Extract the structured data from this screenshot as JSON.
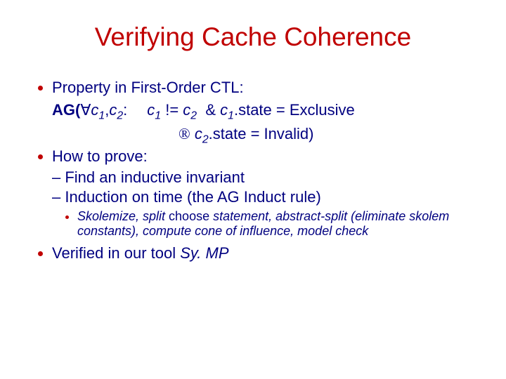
{
  "title": "Verifying Cache Coherence",
  "b1": "Property in First-Order CTL:",
  "f": {
    "ag": "AG(",
    "forall": "∀",
    "c1": "c",
    "s1": "1",
    "comma": ",",
    "c2": "c",
    "s2": "2",
    "colon": ":",
    "ne": "!=",
    "amp": "&",
    "state1": ".state = Exclusive",
    "imp": "®",
    "state2": ".state = Invalid)"
  },
  "b2": "How to prove:",
  "b2a": "Find an inductive invariant",
  "b2b_pre": "Induction on time (the ",
  "b2b_rule": "AG Induct",
  "b2b_post": " rule)",
  "b2c_pre": "Skolemize, split ",
  "b2c_choose": "choose",
  "b2c_post": " statement, abstract-split (eliminate skolem constants), compute cone of influence, model check",
  "b3_pre": "Verified in our tool ",
  "b3_tool": "Sy. MP"
}
